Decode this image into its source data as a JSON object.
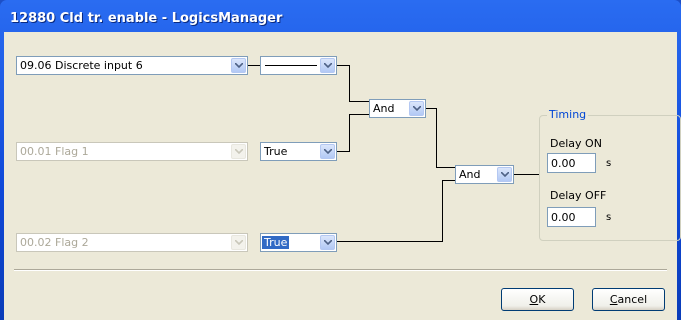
{
  "window": {
    "title": "12880 Cld tr. enable - LogicsManager"
  },
  "inputs": [
    {
      "label": "09.06 Discrete input 6",
      "enabled": true
    },
    {
      "label": "00.01 Flag 1",
      "enabled": false
    },
    {
      "label": "00.02 Flag 2",
      "enabled": false
    }
  ],
  "signs": [
    {
      "value": "",
      "shown_as": "line"
    },
    {
      "value": "True"
    },
    {
      "value": "True",
      "selected": true
    }
  ],
  "operators": [
    {
      "value": "And"
    },
    {
      "value": "And"
    }
  ],
  "timing": {
    "legend": "Timing",
    "delay_on_label": "Delay ON",
    "delay_on_value": "0.00",
    "delay_on_unit": "s",
    "delay_off_label": "Delay OFF",
    "delay_off_value": "0.00",
    "delay_off_unit": "s"
  },
  "buttons": {
    "ok_accel": "O",
    "ok_rest": "K",
    "cancel_accel": "C",
    "cancel_rest": "ancel"
  },
  "colors": {
    "titlebar": "#0f48d8",
    "dialog": "#ece9d8",
    "selection": "#316ac5",
    "group_label": "#0046d5"
  }
}
